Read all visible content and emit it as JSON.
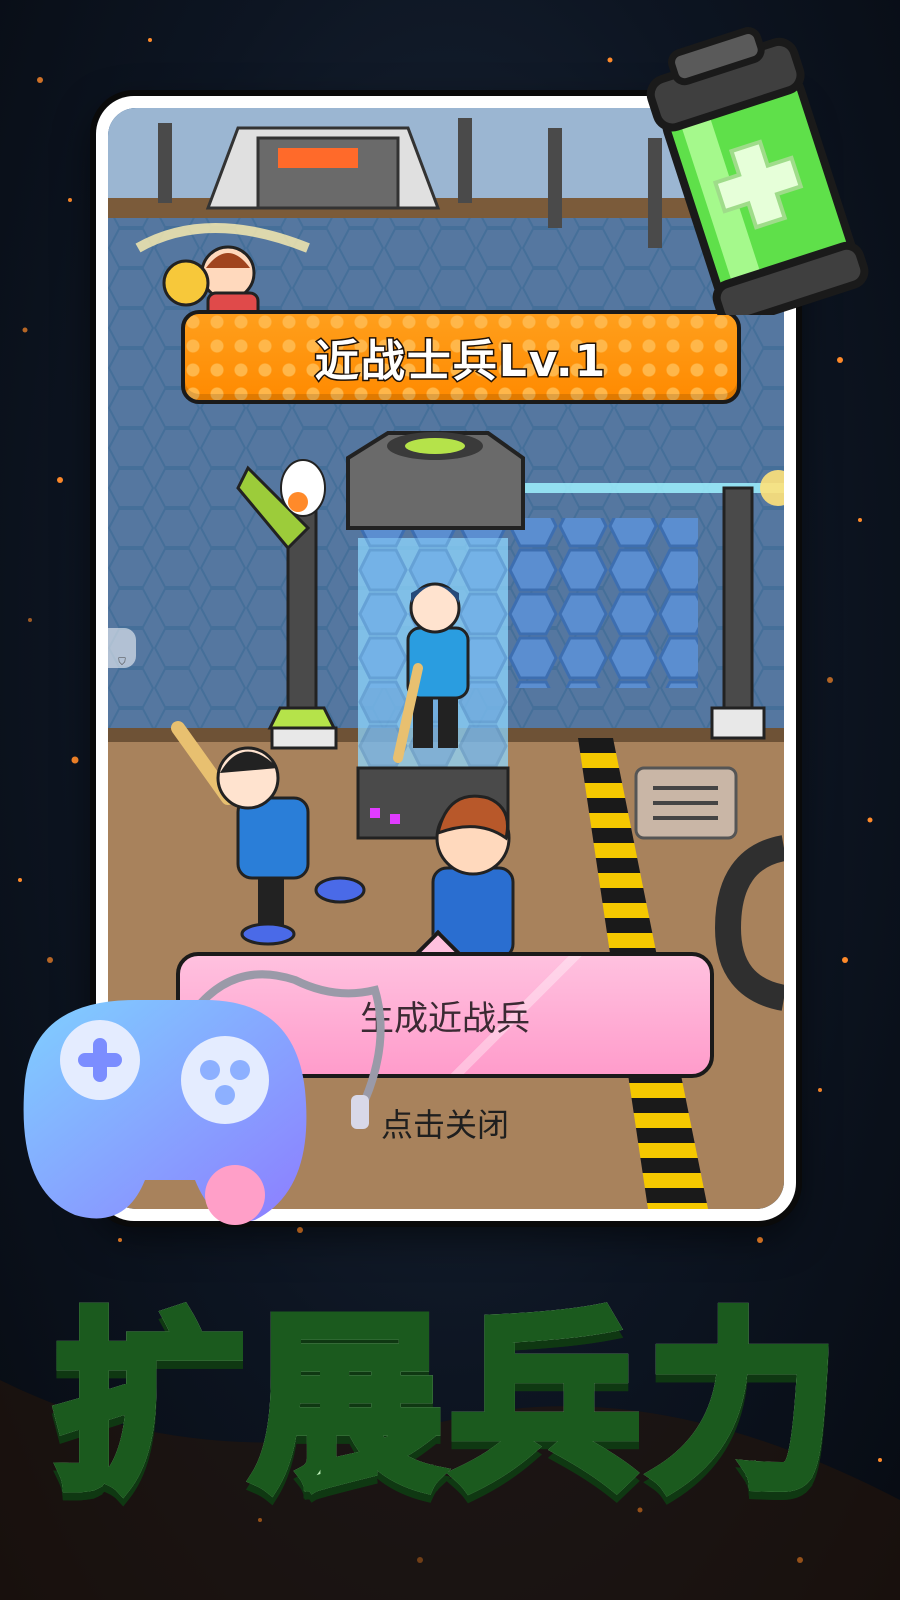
{
  "level_banner": {
    "text": "近战士兵Lv.1"
  },
  "spawn_button": {
    "label": "生成近战兵"
  },
  "close_hint": {
    "text": "点击关闭"
  },
  "title": {
    "text": "扩展兵力"
  },
  "colors": {
    "banner_orange": "#ff9f1c",
    "panel_pink": "#ffb0d6",
    "title_green": "#1b5a1e",
    "battery_green": "#5fe04a"
  },
  "icons": [
    "battery-icon",
    "gamepad-icon",
    "privacy-icon"
  ]
}
